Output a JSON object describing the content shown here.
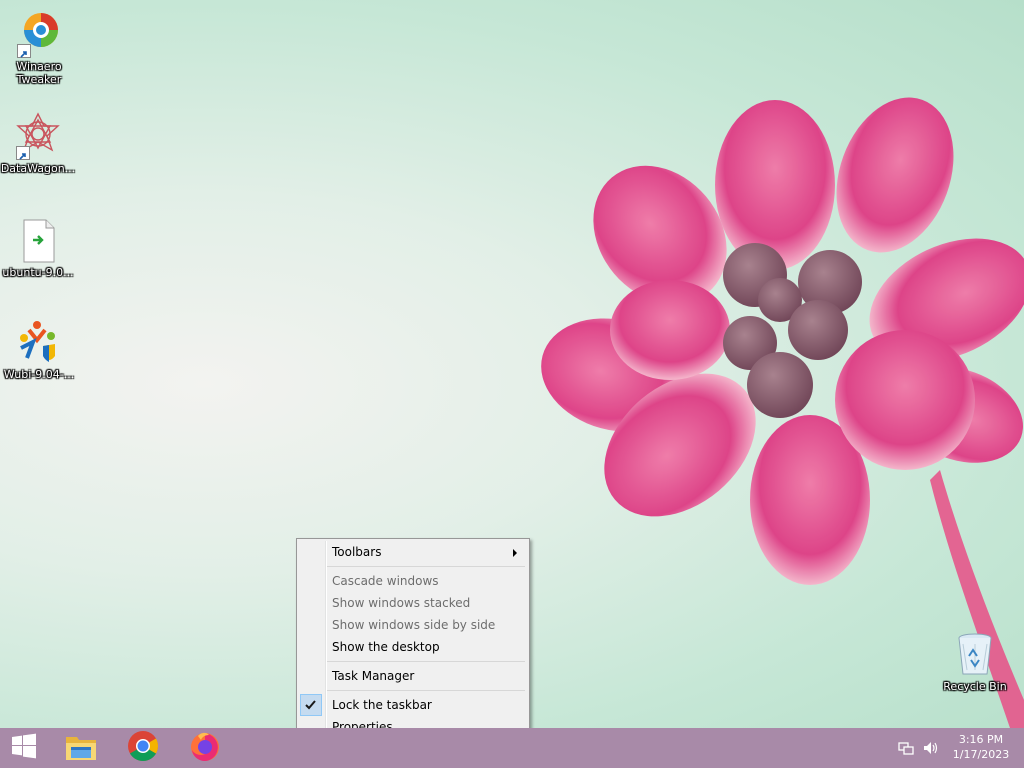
{
  "desktop_icons": [
    {
      "label": "Winaero\nTweaker",
      "icon": "winaero-tweaker-icon"
    },
    {
      "label": "DataWagon...",
      "icon": "datawagon-icon"
    },
    {
      "label": "ubuntu-9.0...",
      "icon": "document-file-icon"
    },
    {
      "label": "Wubi-9.04-...",
      "icon": "wubi-installer-icon"
    },
    {
      "label": "Recycle Bin",
      "icon": "recycle-bin-icon"
    }
  ],
  "context_menu": {
    "toolbars": "Toolbars",
    "cascade": "Cascade windows",
    "stacked": "Show windows stacked",
    "side_by_side": "Show windows side by side",
    "show_desktop": "Show the desktop",
    "task_manager": "Task Manager",
    "lock_taskbar": "Lock the taskbar",
    "lock_checked": true,
    "properties": "Properties"
  },
  "taskbar": {
    "pinned": [
      "windows-start-icon",
      "file-explorer-icon",
      "chrome-icon",
      "firefox-icon"
    ],
    "tray": [
      "network-icon",
      "volume-icon"
    ],
    "time": "3:16 PM",
    "date": "1/17/2023"
  },
  "colors": {
    "taskbar": "#a88aa8",
    "menu_bg": "#f0f0f0",
    "flower": "#e0478a"
  }
}
